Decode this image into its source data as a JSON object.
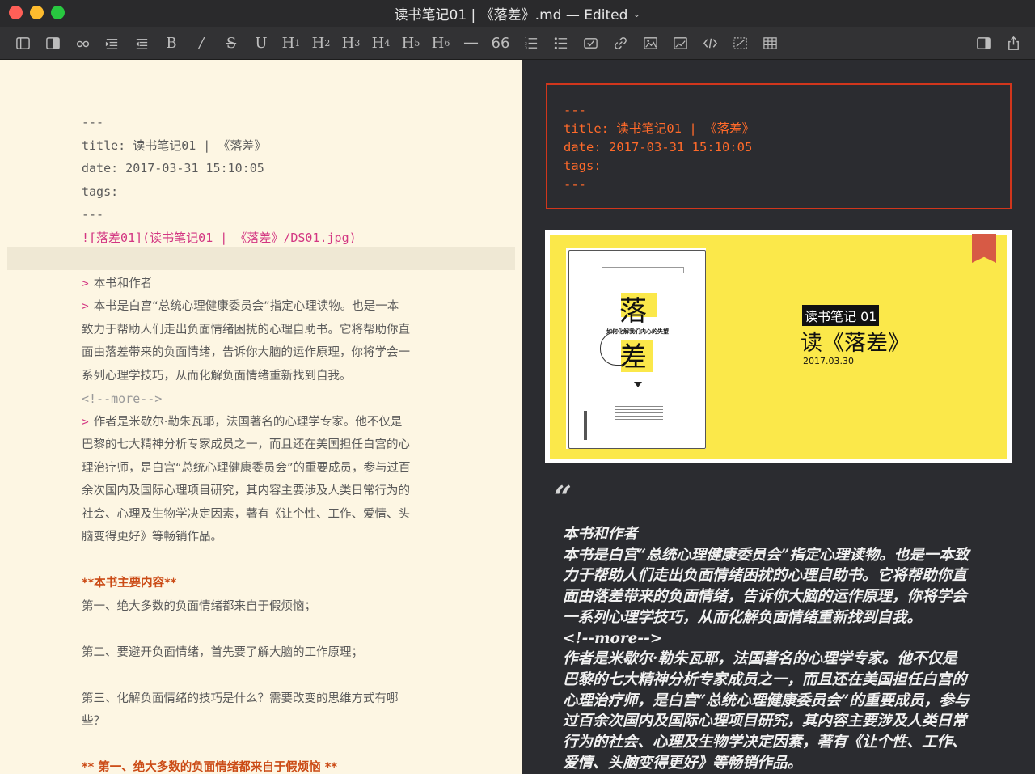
{
  "window": {
    "title": "读书笔记01 | 《落差》.md — Edited"
  },
  "toolbar": {
    "items": [
      "sidebar-left",
      "sidebar-right",
      "link",
      "align",
      "align-indent",
      "B",
      "I",
      "S",
      "U",
      "H1",
      "H2",
      "H3",
      "H4",
      "H5",
      "H6",
      "—",
      "66",
      "ordered-list",
      "unordered-list",
      "task",
      "hyperlink",
      "image",
      "image-edit",
      "code",
      "table-dotted",
      "table",
      "preview-toggle",
      "share"
    ]
  },
  "editor": {
    "front_open": "---",
    "front_title": "title: 读书笔记01 | 《落差》",
    "front_date": "date: 2017-03-31 15:10:05",
    "front_tags": "tags:",
    "front_close": "---",
    "image_line": "![落差01](读书笔记01 | 《落差》/DS01.jpg)",
    "quote_marker": ">",
    "q1": "本书和作者",
    "q2_lines": [
      "本书是白宫“总统心理健康委员会”指定心理读物。也是一本",
      "致力于帮助人们走出负面情绪困扰的心理自助书。它将帮助你直",
      "面由落差带来的负面情绪，告诉你大脑的运作原理，你将学会一",
      "系列心理学技巧，从而化解负面情绪重新找到自我。"
    ],
    "more": "<!--more-->",
    "q3_lines": [
      "作者是米歇尔·勒朱瓦耶，法国著名的心理学专家。他不仅是",
      "巴黎的七大精神分析专家成员之一，而且还在美国担任白宫的心",
      "理治疗师，是白宫“总统心理健康委员会”的重要成员，参与过百",
      "余次国内及国际心理项目研究，其内容主要涉及人类日常行为的",
      "社会、心理及生物学决定因素，著有《让个性、工作、爱情、头",
      "脑变得更好》等畅销作品。"
    ],
    "bold_heading": "**本书主要内容**",
    "p1": "第一、绝大多数的负面情绪都来自于假烦恼；",
    "p2": "第二、要避开负面情绪，首先要了解大脑的工作原理；",
    "p3_lines": [
      "第三、化解负面情绪的技巧是什么？需要改变的思维方式有哪",
      "些？"
    ],
    "bold_last": "**  第一、绝大多数的负面情绪都来自于假烦恼   **"
  },
  "preview": {
    "front_open": "---",
    "front_title": "title: 读书笔记01 | 《落差》",
    "front_date": "date: 2017-03-31 15:10:05",
    "front_tags": "tags:",
    "front_close": "---",
    "cover_label": "读书笔记 01",
    "cover_title": "读《落差》",
    "cover_date": "2017.03.30",
    "book_big_char": "落",
    "book_big_char2": "差",
    "book_subtitle": "如何化解我们内心的失望",
    "quote_glyph": "“",
    "bq_heading": "本书和作者",
    "bq_lines1": [
      "本书是白宫“总统心理健康委员会”指定心理读物。也是一本致",
      "力于帮助人们走出负面情绪困扰的心理自助书。它将帮助你直",
      "面由落差带来的负面情绪，告诉你大脑的运作原理，你将学会",
      "一系列心理学技巧，从而化解负面情绪重新找到自我。"
    ],
    "bq_more": "<!--more-->",
    "bq_lines2": [
      "作者是米歇尔·勒朱瓦耶，法国著名的心理学专家。他不仅是",
      "巴黎的七大精神分析专家成员之一，而且还在美国担任白宫的",
      "心理治疗师，是白宫“总统心理健康委员会”的重要成员，参与",
      "过百余次国内及国际心理项目研究，其内容主要涉及人类日常",
      "行为的社会、心理及生物学决定因素，著有《让个性、工作、",
      "爱情、头脑变得更好》等畅销作品。"
    ]
  }
}
